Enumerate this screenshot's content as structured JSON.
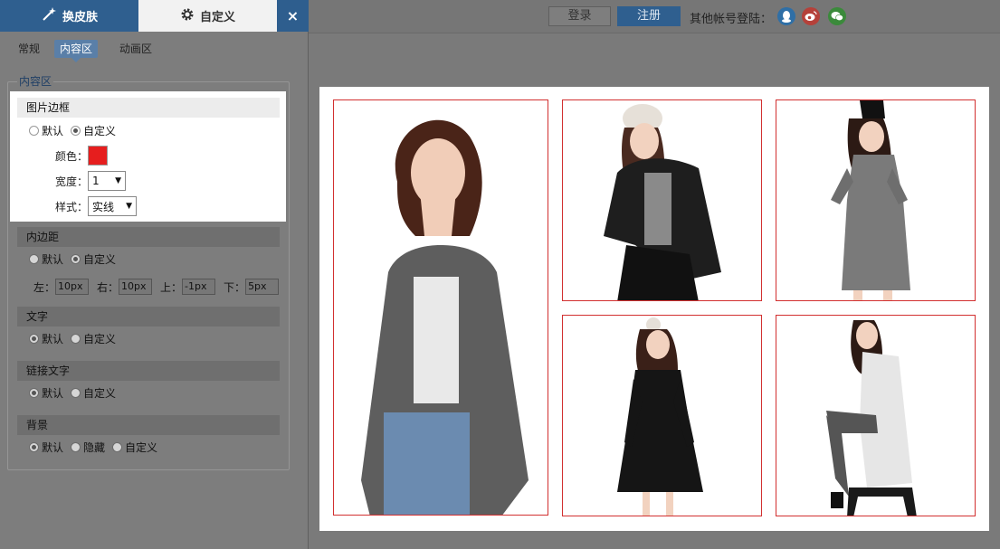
{
  "panel": {
    "tabs": [
      {
        "label": "换皮肤",
        "icon": "magic-wand-icon"
      },
      {
        "label": "自定义",
        "icon": "gear-icon"
      }
    ],
    "close_label": "×",
    "subtabs": [
      "常规",
      "内容区",
      "动画区"
    ],
    "fieldset_legend": "内容区",
    "sections": {
      "border": {
        "title": "图片边框",
        "options": [
          "默认",
          "自定义"
        ],
        "selected": "自定义",
        "color_label": "颜色：",
        "color_value": "#e61e1e",
        "width_label": "宽度：",
        "width_value": "1",
        "style_label": "样式：",
        "style_value": "实线"
      },
      "padding": {
        "title": "内边距",
        "options": [
          "默认",
          "自定义"
        ],
        "selected": "自定义",
        "left_label": "左：",
        "left_value": "10px",
        "right_label": "右：",
        "right_value": "10px",
        "top_label": "上：",
        "top_value": "-1px",
        "bottom_label": "下：",
        "bottom_value": "5px"
      },
      "text": {
        "title": "文字",
        "options": [
          "默认",
          "自定义"
        ],
        "selected": "默认"
      },
      "link_text": {
        "title": "链接文字",
        "options": [
          "默认",
          "自定义"
        ],
        "selected": "默认"
      },
      "background": {
        "title": "背景",
        "options": [
          "默认",
          "隐藏",
          "自定义"
        ],
        "selected": "默认"
      }
    }
  },
  "topbar": {
    "login": "登录",
    "register": "注册",
    "other_login": "其他帐号登陆："
  },
  "colors": {
    "accent": "#2f5f8f",
    "photo_border": "#d23030"
  }
}
